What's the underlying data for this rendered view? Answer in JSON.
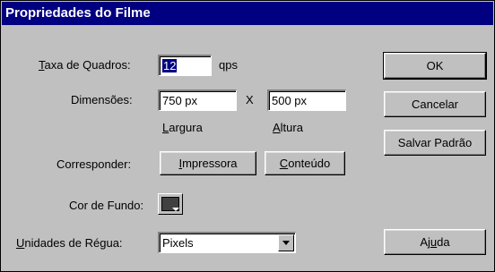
{
  "dialog": {
    "title": "Propriedades do Filme"
  },
  "frame_rate": {
    "label_prefix": "",
    "label_u": "T",
    "label_rest": "axa de Quadros:",
    "value": "12",
    "unit": "qps"
  },
  "dimensions": {
    "label": "Dimensões:",
    "width_value": "750 px",
    "height_value": "500 px",
    "separator": "X",
    "width_caption_u": "L",
    "width_caption_rest": "argura",
    "height_caption_u": "A",
    "height_caption_rest": "ltura"
  },
  "match": {
    "label": "Corresponder:",
    "printer_u": "I",
    "printer_rest": "mpressora",
    "contents_u": "C",
    "contents_rest": "onteúdo"
  },
  "background": {
    "label": "Cor de Fundo:",
    "color": "#404040"
  },
  "ruler_units": {
    "label_u": "U",
    "label_rest": "nidades de Régua:",
    "selected": "Pixels"
  },
  "buttons": {
    "ok": "OK",
    "cancel": "Cancelar",
    "save_default": "Salvar Padrão",
    "help_pre": "Aj",
    "help_u": "u",
    "help_post": "da"
  }
}
